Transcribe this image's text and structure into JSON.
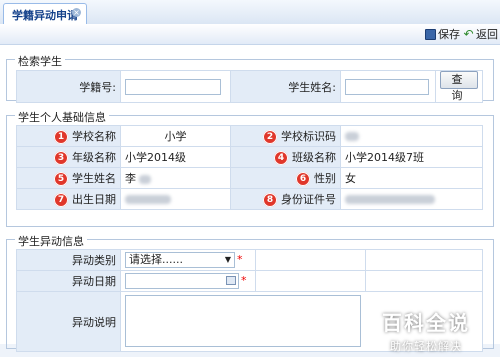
{
  "tab": {
    "title": "学籍异动申请",
    "close": "×"
  },
  "toolbar": {
    "save_label": "保存",
    "back_label": "返回"
  },
  "search": {
    "legend": "检索学生",
    "student_id_label": "学籍号:",
    "student_name_label": "学生姓名:",
    "query_button": "查 询"
  },
  "basic": {
    "legend": "学生个人基础信息",
    "rows": [
      {
        "b1": "1",
        "l1": "学校名称",
        "v1": "小学",
        "b2": "2",
        "l2": "学校标识码",
        "v2": ""
      },
      {
        "b1": "3",
        "l1": "年级名称",
        "v1": "小学2014级",
        "b2": "4",
        "l2": "班级名称",
        "v2": "小学2014级7班"
      },
      {
        "b1": "5",
        "l1": "学生姓名",
        "v1": "李",
        "b2": "6",
        "l2": "性别",
        "v2": "女"
      },
      {
        "b1": "7",
        "l1": "出生日期",
        "v1": "",
        "b2": "8",
        "l2": "身份证件号",
        "v2": ""
      }
    ]
  },
  "change": {
    "legend": "学生异动信息",
    "type_label": "异动类别",
    "type_value": "请选择......",
    "date_label": "异动日期",
    "desc_label": "异动说明",
    "required_mark": "*"
  },
  "watermark": {
    "title": "百科全说",
    "subtitle": "助你轻松解决"
  }
}
